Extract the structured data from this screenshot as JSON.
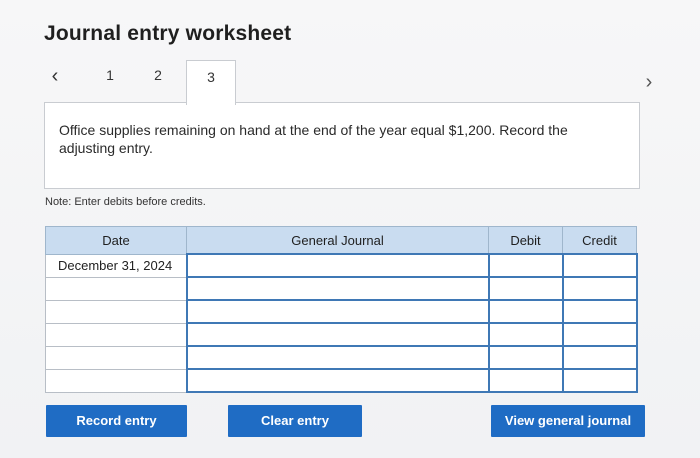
{
  "header": {
    "title": "Journal entry worksheet"
  },
  "tabs": {
    "prev_icon": "‹",
    "next_icon": "›",
    "items": [
      {
        "label": "1"
      },
      {
        "label": "2"
      },
      {
        "label": "3",
        "active": true
      }
    ]
  },
  "question": {
    "text": "Office supplies remaining on hand at the end of the year equal $1,200. Record the adjusting entry."
  },
  "note": "Note: Enter debits before credits.",
  "journal": {
    "headers": {
      "date": "Date",
      "general_journal": "General Journal",
      "debit": "Debit",
      "credit": "Credit"
    },
    "rows": [
      {
        "date": "December 31, 2024",
        "account": "",
        "debit": "",
        "credit": ""
      },
      {
        "date": "",
        "account": "",
        "debit": "",
        "credit": ""
      },
      {
        "date": "",
        "account": "",
        "debit": "",
        "credit": ""
      },
      {
        "date": "",
        "account": "",
        "debit": "",
        "credit": ""
      },
      {
        "date": "",
        "account": "",
        "debit": "",
        "credit": ""
      },
      {
        "date": "",
        "account": "",
        "debit": "",
        "credit": ""
      }
    ]
  },
  "buttons": {
    "record_entry": "Record entry",
    "clear_entry": "Clear entry",
    "view_general_journal": "View general journal"
  },
  "colors": {
    "button_blue": "#1f6cc4",
    "header_blue": "#c9dcf0",
    "input_border_blue": "#3f78b5"
  }
}
